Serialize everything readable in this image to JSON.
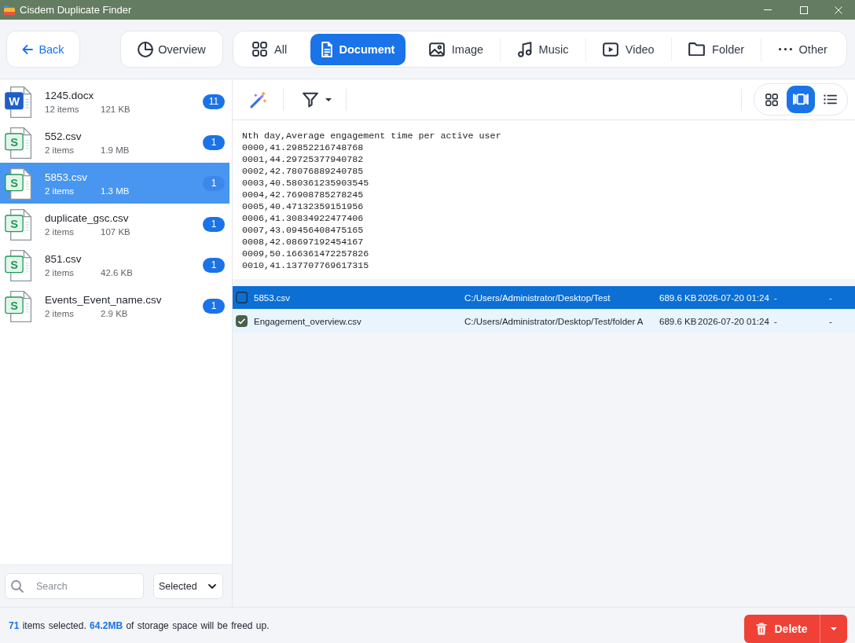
{
  "window": {
    "title": "Cisdem Duplicate Finder"
  },
  "nav": {
    "back": "Back",
    "overview": "Overview"
  },
  "categories": [
    {
      "label": "All",
      "kind": "all",
      "selected": false
    },
    {
      "label": "Document",
      "kind": "document",
      "selected": true
    },
    {
      "label": "Image",
      "kind": "image",
      "selected": false
    },
    {
      "label": "Music",
      "kind": "music",
      "selected": false
    },
    {
      "label": "Video",
      "kind": "video",
      "selected": false
    },
    {
      "label": "Folder",
      "kind": "folder",
      "selected": false
    },
    {
      "label": "Other",
      "kind": "other",
      "selected": false
    }
  ],
  "groups": [
    {
      "name": "1245.docx",
      "kind": "word",
      "icon_letter": "W",
      "items": "12 items",
      "size": "121 KB",
      "count": "11",
      "selected": false
    },
    {
      "name": "552.csv",
      "kind": "sheet",
      "icon_letter": "S",
      "items": "2 items",
      "size": "1.9 MB",
      "count": "1",
      "selected": false
    },
    {
      "name": "5853.csv",
      "kind": "sheet",
      "icon_letter": "S",
      "items": "2 items",
      "size": "1.3 MB",
      "count": "1",
      "selected": true
    },
    {
      "name": "duplicate_gsc.csv",
      "kind": "sheet",
      "icon_letter": "S",
      "items": "2 items",
      "size": "107 KB",
      "count": "1",
      "selected": false
    },
    {
      "name": "851.csv",
      "kind": "sheet",
      "icon_letter": "S",
      "items": "2 items",
      "size": "42.6 KB",
      "count": "1",
      "selected": false
    },
    {
      "name": "Events_Event_name.csv",
      "kind": "sheet",
      "icon_letter": "S",
      "items": "2 items",
      "size": "2.9 KB",
      "count": "1",
      "selected": false
    }
  ],
  "search": {
    "placeholder": "Search"
  },
  "scope_select": {
    "value": "Selected"
  },
  "view_modes": [
    {
      "kind": "grid",
      "selected": false
    },
    {
      "kind": "preview",
      "selected": true
    },
    {
      "kind": "list",
      "selected": false
    }
  ],
  "preview": {
    "lines": [
      "Nth day,Average engagement time per active user",
      "0000,41.29852216748768",
      "0001,44.29725377940782",
      "0002,42.78076889240785",
      "0003,40.580361235903545",
      "0004,42.76908785278245",
      "0005,40.47132359151956",
      "0006,41.30834922477406",
      "0007,43.09456408475165",
      "0008,42.08697192454167",
      "0009,50.166361472257826",
      "0010,41.137707769617315"
    ]
  },
  "files": [
    {
      "name": "5853.csv",
      "path": "C:/Users/Administrator/Desktop/Test",
      "size": "689.6 KB",
      "modified": "2026-07-20 01:24",
      "column_5": "-",
      "column_6": "-",
      "selected": true,
      "checked": false
    },
    {
      "name": "Engagement_overview.csv",
      "path": "C:/Users/Administrator/Desktop/Test/folder A",
      "size": "689.6 KB",
      "modified": "2026-07-20 01:24",
      "column_5": "-",
      "column_6": "-",
      "selected": false,
      "checked": true
    }
  ],
  "status_bar": {
    "summary": "**71** items selected. **64.2MB** of storage space will be freed up."
  },
  "delete_button": {
    "label": "Delete"
  }
}
